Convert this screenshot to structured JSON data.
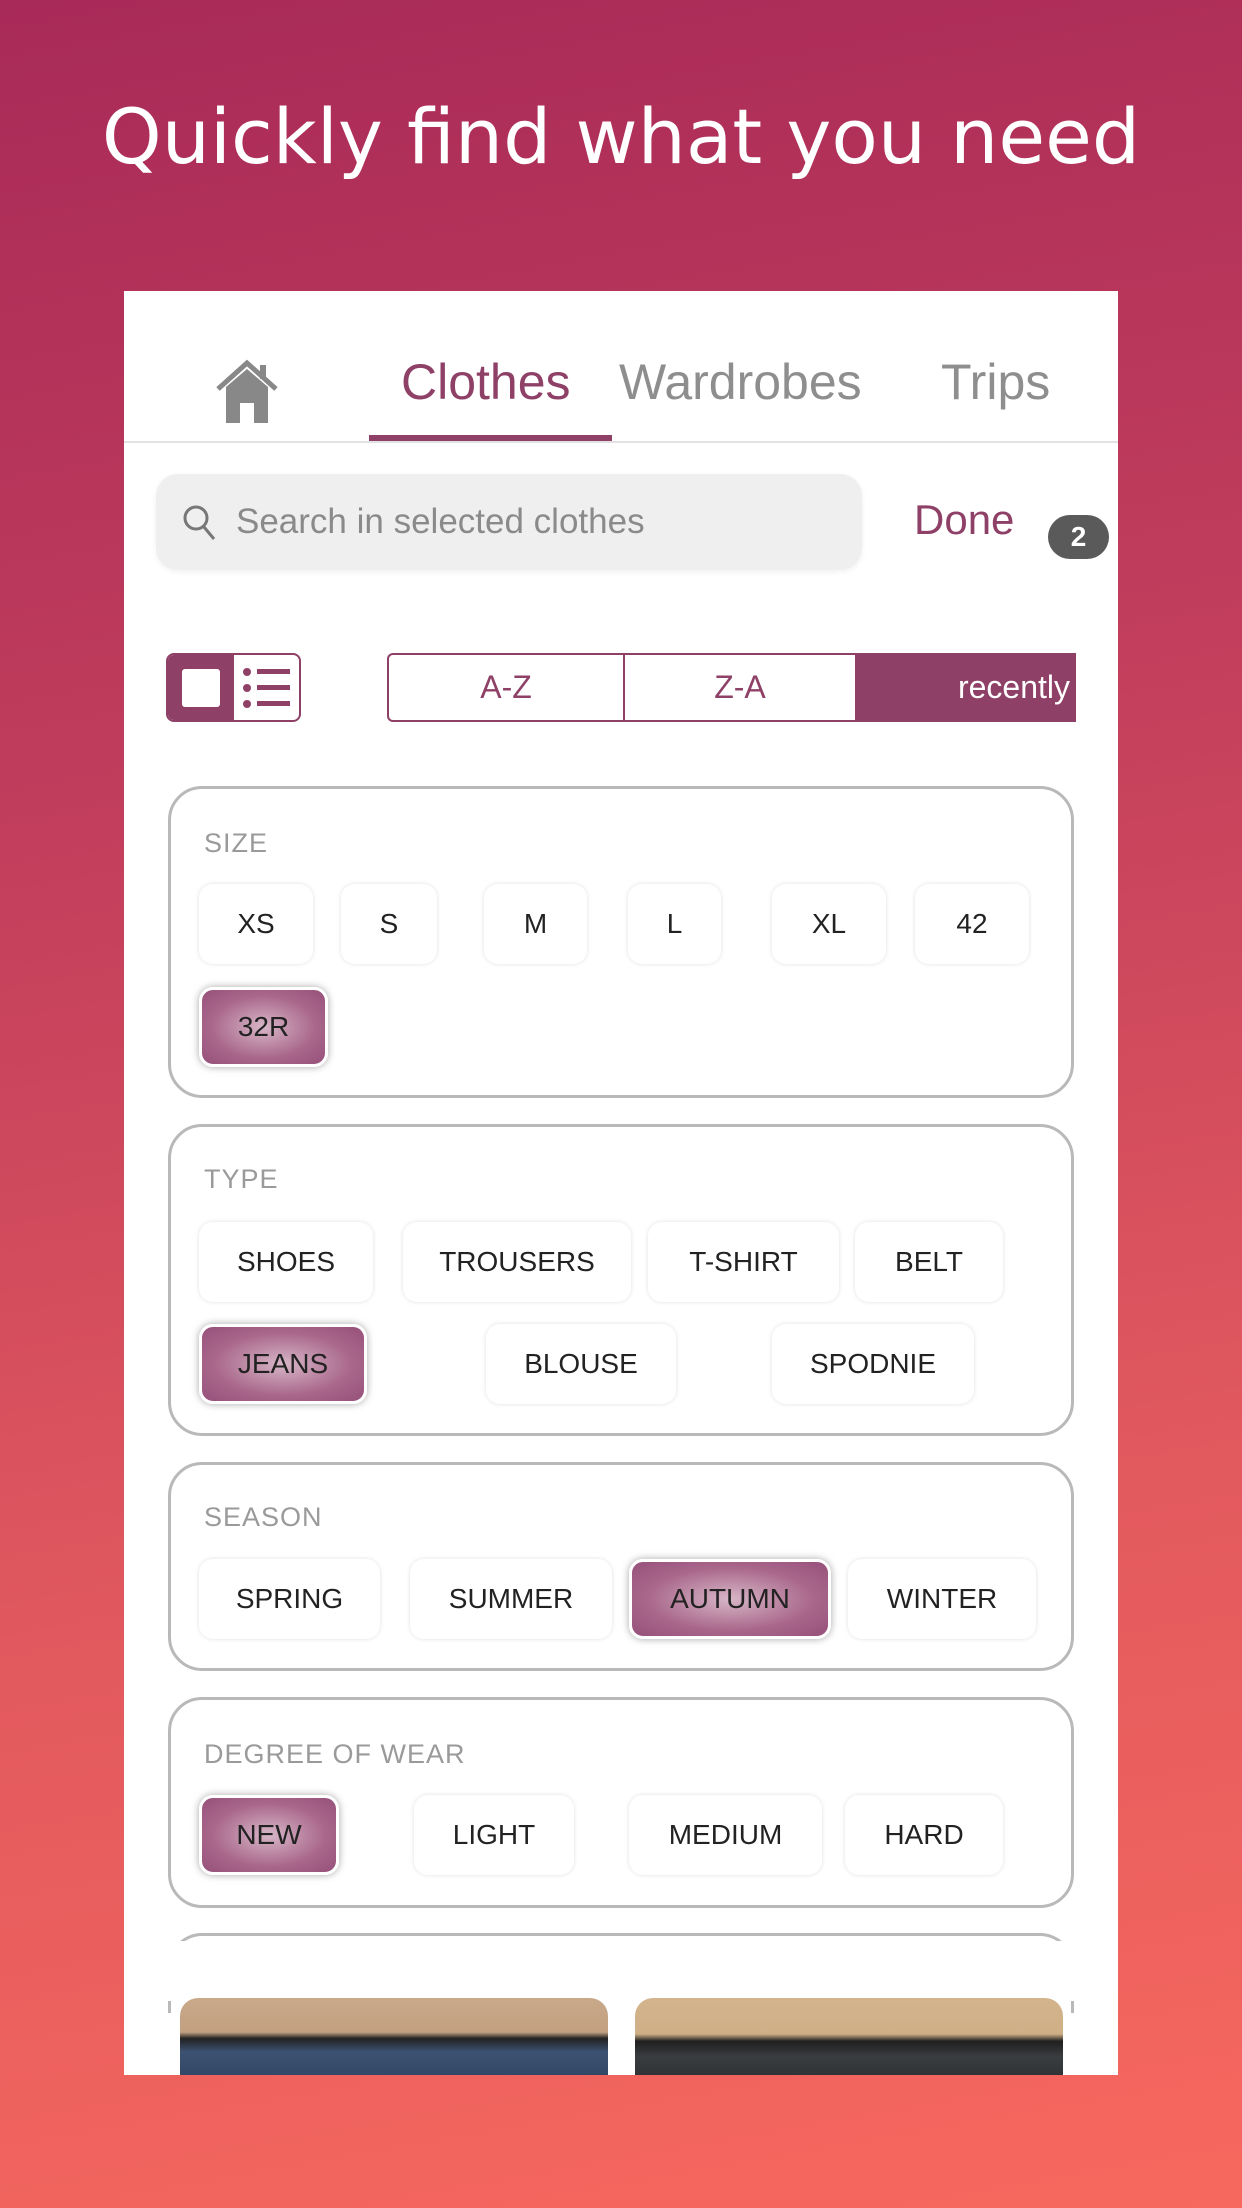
{
  "headline": "Quickly find what you need",
  "tabs": {
    "home_icon": "home-icon",
    "clothes": "Clothes",
    "wardrobes": "Wardrobes",
    "trips": "Trips"
  },
  "search": {
    "placeholder": "Search in selected clothes",
    "icon": "search-icon"
  },
  "done": "Done",
  "badge": "2",
  "view_toggle": {
    "selected": "grid",
    "options": [
      "grid",
      "list"
    ]
  },
  "sort": {
    "options": [
      "A-Z",
      "Z-A",
      "recently"
    ],
    "selected": "recently"
  },
  "filters": {
    "size": {
      "label": "SIZE",
      "options": [
        "XS",
        "S",
        "M",
        "L",
        "XL",
        "42",
        "32R"
      ],
      "selected": [
        "32R"
      ]
    },
    "type": {
      "label": "TYPE",
      "options": [
        "SHOES",
        "TROUSERS",
        "T-SHIRT",
        "BELT",
        "JEANS",
        "BLOUSE",
        "SPODNIE"
      ],
      "selected": [
        "JEANS"
      ]
    },
    "season": {
      "label": "SEASON",
      "options": [
        "SPRING",
        "SUMMER",
        "AUTUMN",
        "WINTER"
      ],
      "selected": [
        "AUTUMN"
      ]
    },
    "wear": {
      "label": "DEGREE OF WEAR",
      "options": [
        "NEW",
        "LIGHT",
        "MEDIUM",
        "HARD"
      ],
      "selected": [
        "NEW"
      ]
    }
  },
  "colors": {
    "accent": "#8e4066",
    "bg_top": "#a82a58",
    "bg_bottom": "#f7685e"
  }
}
